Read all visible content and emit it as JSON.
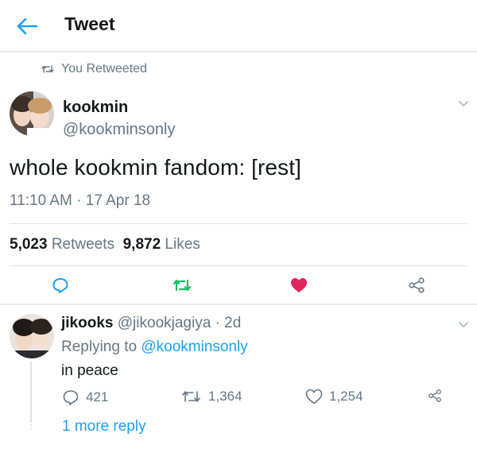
{
  "header": {
    "title": "Tweet",
    "back_icon": "back-arrow-icon"
  },
  "retweet_context": {
    "label": "You Retweeted"
  },
  "tweet": {
    "display_name": "kookmin",
    "handle": "@kookminsonly",
    "text": "whole kookmin fandom: [rest]",
    "timestamp": "11:10 AM · 17 Apr 18",
    "retweet_count": "5,023",
    "retweet_label": "Retweets",
    "like_count": "9,872",
    "like_label": "Likes"
  },
  "reply": {
    "display_name": "jikooks",
    "handle_time": "@jikookjagiya · 2d",
    "replying_prefix": "Replying to",
    "replying_to": "@kookminsonly",
    "text": "in peace",
    "reply_count": "421",
    "retweet_count": "1,364",
    "like_count": "1,254",
    "more_replies": "1 more reply"
  },
  "colors": {
    "accent_blue": "#1da1f2",
    "retweet_green": "#17bf63",
    "like_red": "#e0245e",
    "secondary_text": "#657786"
  }
}
